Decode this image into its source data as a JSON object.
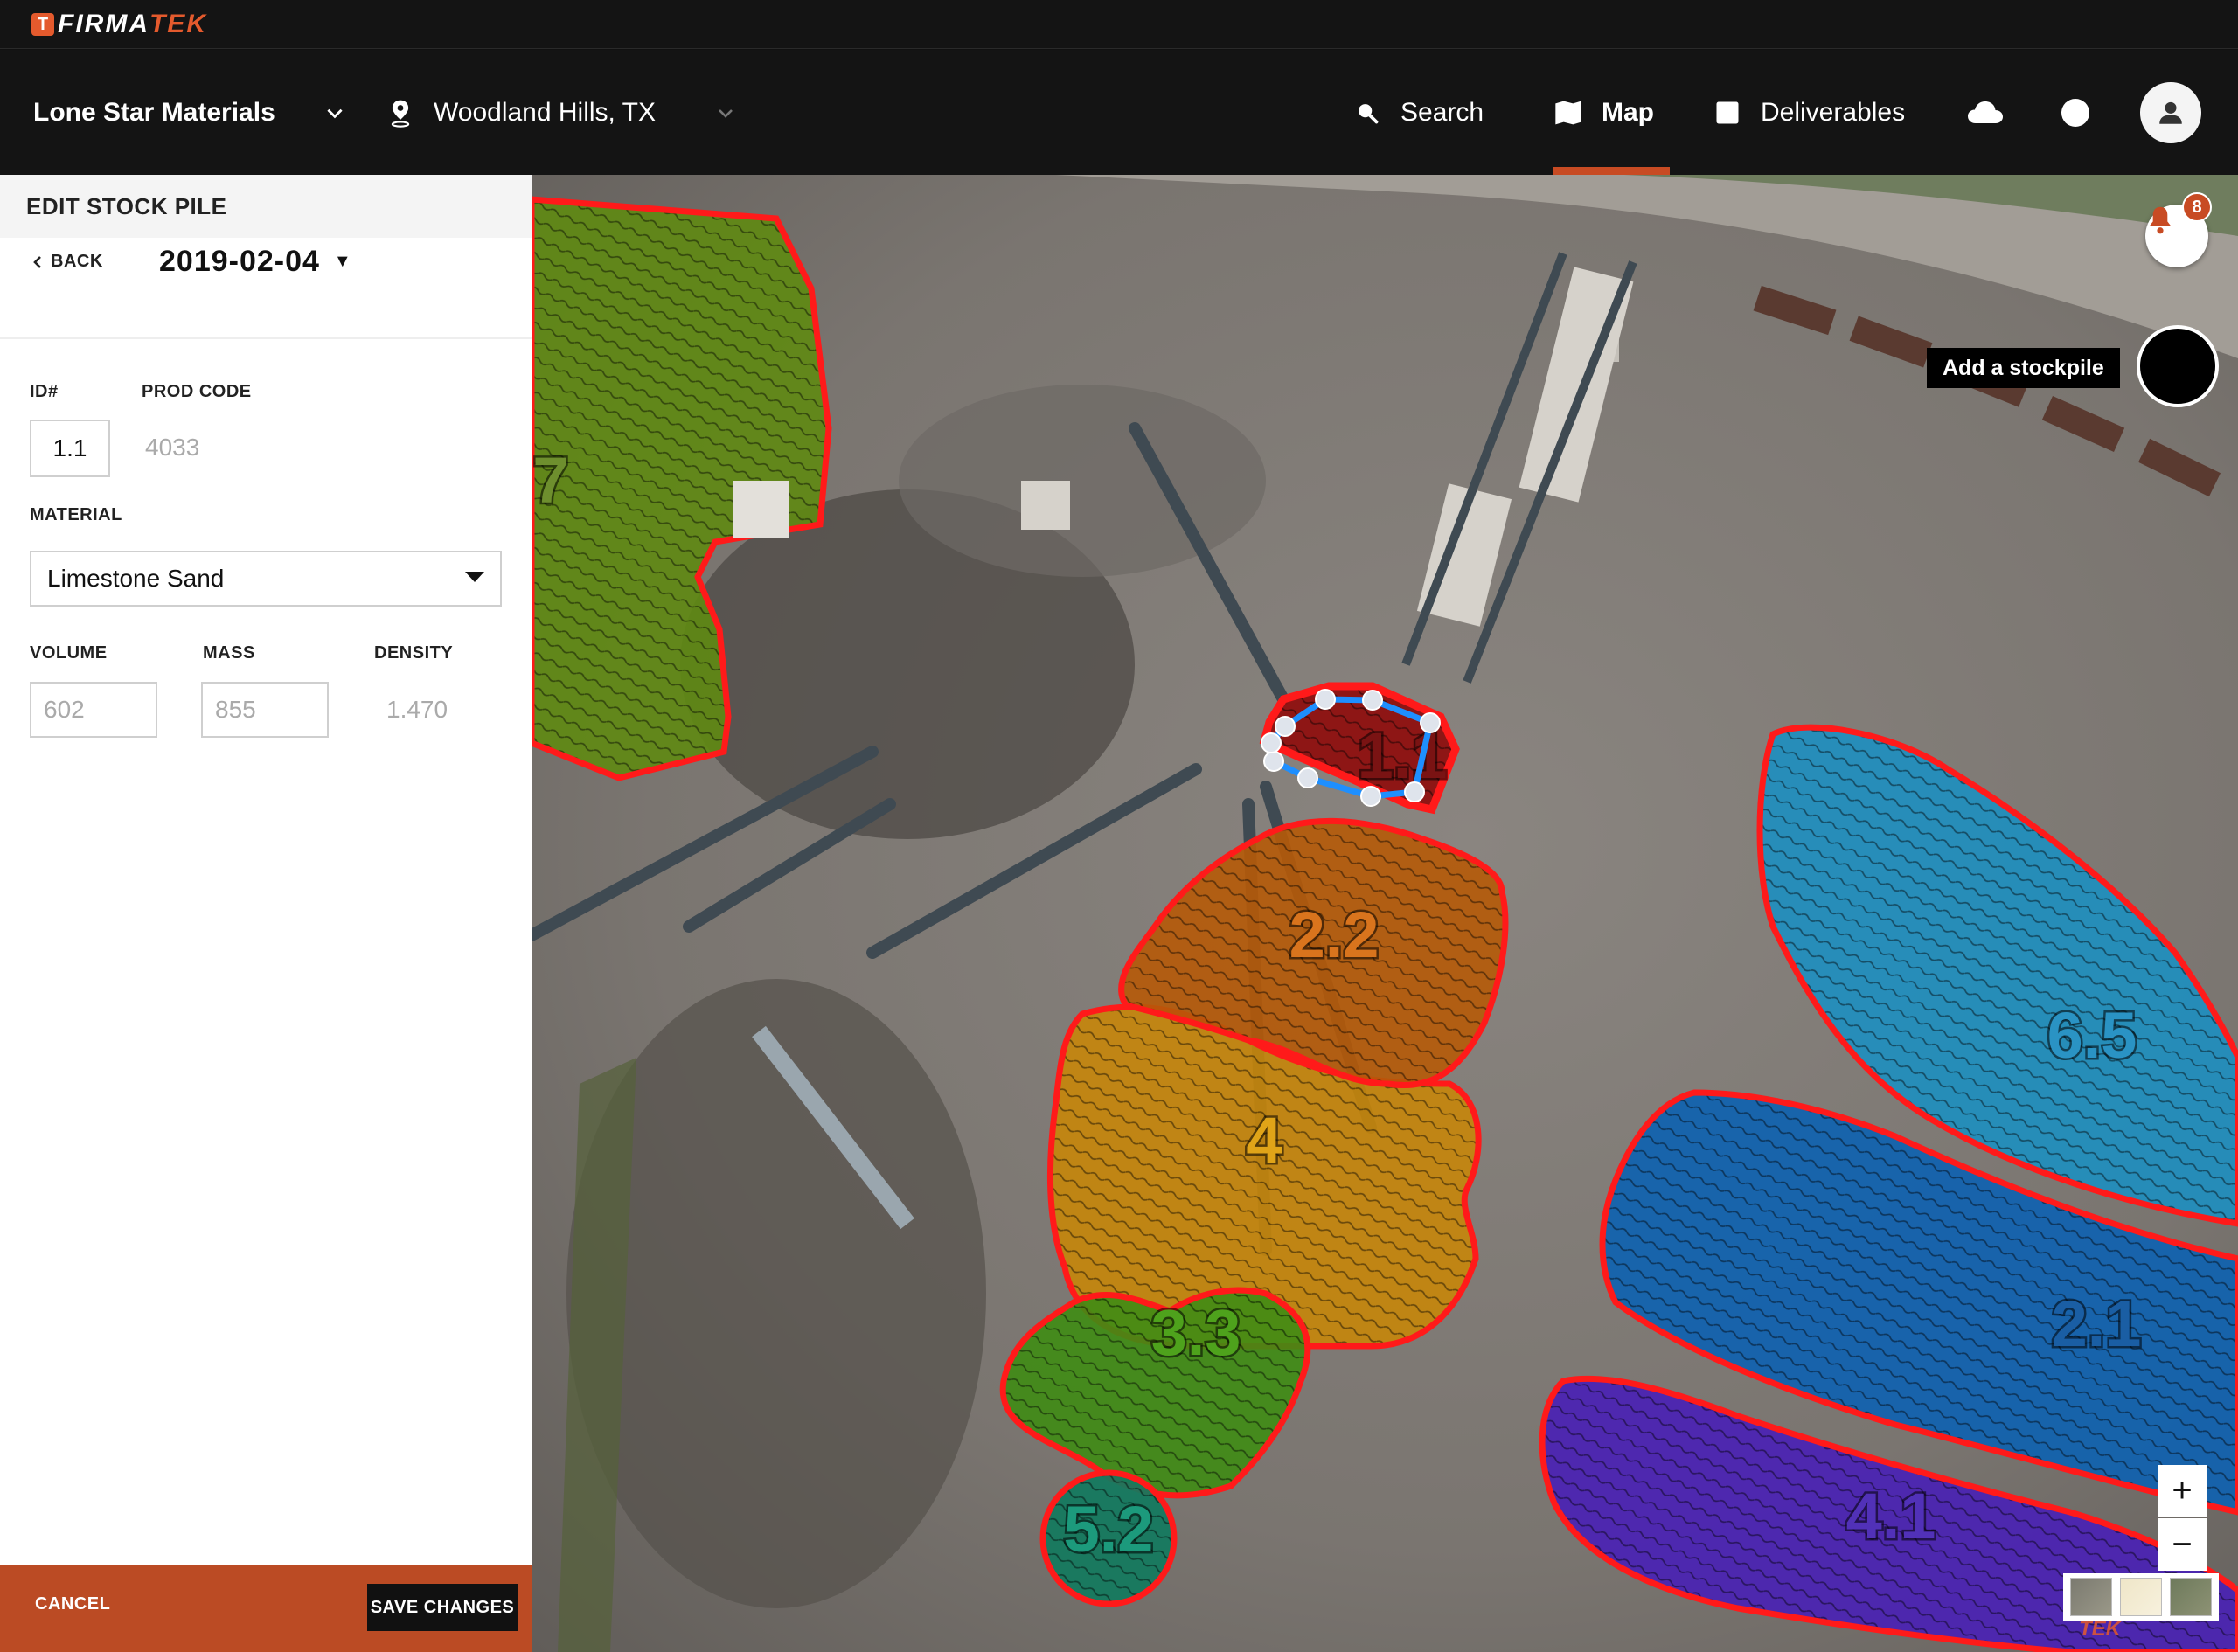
{
  "brand": {
    "logo_mark": "T",
    "name_part1": "FIRMA",
    "name_part2": "TEK",
    "brand_color": "#e45a2d"
  },
  "nav": {
    "company": "Lone Star Materials",
    "location": "Woodland Hills, TX",
    "search_label": "Search",
    "map_label": "Map",
    "deliverables_label": "Deliverables",
    "icons": [
      "chevron-down-icon",
      "location-pin-icon",
      "search-icon",
      "map-icon",
      "deliverables-icon",
      "cloud-icon",
      "status-dot-icon",
      "user-icon"
    ],
    "active_tab": "Map",
    "accent_color": "#c84b23"
  },
  "panel": {
    "title": "EDIT STOCK PILE",
    "back_label": "BACK",
    "date": "2019-02-04",
    "id_label": "ID#",
    "id_value": "1.1",
    "prod_code_label": "PROD CODE",
    "prod_code_value": "4033",
    "material_label": "MATERIAL",
    "material_value": "Limestone Sand",
    "volume_label": "VOLUME",
    "volume_value": "602",
    "mass_label": "MASS",
    "mass_value": "855",
    "density_label": "DENSITY",
    "density_value": "1.470",
    "cancel_label": "CANCEL",
    "save_label": "SAVE CHANGES"
  },
  "map": {
    "notification_count": "8",
    "add_stockpile_tooltip": "Add a stockpile",
    "zoom_in_label": "+",
    "zoom_out_label": "−",
    "watermark": "TEK",
    "stockpiles": [
      {
        "label": "7",
        "color": "#5f8a12"
      },
      {
        "label": "1.1",
        "color": "#8e1010",
        "selected": true
      },
      {
        "label": "2.2",
        "color": "#b65a08"
      },
      {
        "label": "4",
        "color": "#c7860a"
      },
      {
        "label": "3.3",
        "color": "#3f8c14"
      },
      {
        "label": "5.2",
        "color": "#127a5e"
      },
      {
        "label": "6.5",
        "color": "#1d8fc0"
      },
      {
        "label": "2.1",
        "color": "#0f62b0"
      },
      {
        "label": "4.1",
        "color": "#4a22b4"
      }
    ],
    "outline_color": "#ff1a1a",
    "edit_outline_color": "#1e8fff"
  }
}
